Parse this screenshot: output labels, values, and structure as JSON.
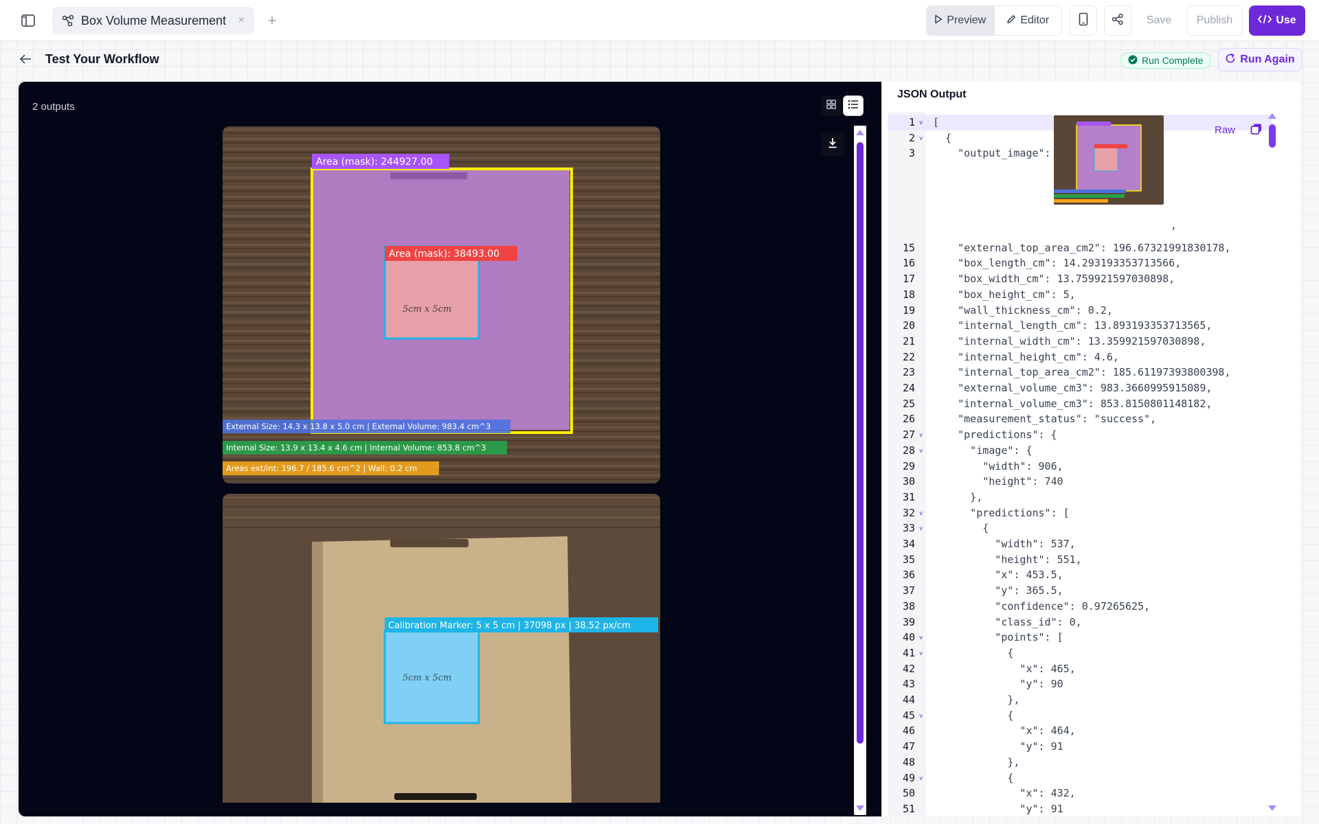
{
  "tab": {
    "label": "Box Volume Measurement",
    "close": "×",
    "add": "+"
  },
  "toolbar": {
    "preview_label": "Preview",
    "editor_label": "Editor",
    "save_label": "Save",
    "publish_label": "Publish",
    "use_label": "Use"
  },
  "header": {
    "title": "Test Your Workflow",
    "status": "Run Complete",
    "run_again_label": "Run Again"
  },
  "outputs": {
    "count_label": "2 outputs",
    "image1": {
      "area_mask_outer": "Area (mask): 244927.00",
      "area_mask_inner": "Area (mask): 38493.00",
      "external_line": "External Size: 14.3 x 13.8 x 5.0 cm | External Volume: 983.4 cm^3",
      "internal_line": "Internal Size: 13.9 x 13.4 x 4.6 cm | Internal Volume: 853.8 cm^3",
      "areas_line": "Areas ext/int: 196.7 / 185.6 cm^2 | Wall: 0.2 cm",
      "marker_text": "5cm x 5cm"
    },
    "image2": {
      "calibration_label": "Calibration Marker: 5 x 5 cm | 37098 px | 38.52 px/cm",
      "marker_text": "5cm x 5cm"
    }
  },
  "json_panel": {
    "title": "JSON Output",
    "raw_label": "Raw",
    "lines": [
      {
        "n": "1",
        "fold": true,
        "t": "["
      },
      {
        "n": "2",
        "fold": true,
        "t": "  {"
      },
      {
        "n": "3",
        "fold": false,
        "t": "    \"output_image\":"
      },
      {
        "n": "15",
        "fold": false,
        "t": "    \"external_top_area_cm2\": 196.67321991830178,"
      },
      {
        "n": "16",
        "fold": false,
        "t": "    \"box_length_cm\": 14.293193353713566,"
      },
      {
        "n": "17",
        "fold": false,
        "t": "    \"box_width_cm\": 13.759921597030898,"
      },
      {
        "n": "18",
        "fold": false,
        "t": "    \"box_height_cm\": 5,"
      },
      {
        "n": "19",
        "fold": false,
        "t": "    \"wall_thickness_cm\": 0.2,"
      },
      {
        "n": "20",
        "fold": false,
        "t": "    \"internal_length_cm\": 13.893193353713565,"
      },
      {
        "n": "21",
        "fold": false,
        "t": "    \"internal_width_cm\": 13.359921597030898,"
      },
      {
        "n": "22",
        "fold": false,
        "t": "    \"internal_height_cm\": 4.6,"
      },
      {
        "n": "23",
        "fold": false,
        "t": "    \"internal_top_area_cm2\": 185.61197393800398,"
      },
      {
        "n": "24",
        "fold": false,
        "t": "    \"external_volume_cm3\": 983.3660995915089,"
      },
      {
        "n": "25",
        "fold": false,
        "t": "    \"internal_volume_cm3\": 853.8150801148182,"
      },
      {
        "n": "26",
        "fold": false,
        "t": "    \"measurement_status\": \"success\","
      },
      {
        "n": "27",
        "fold": true,
        "t": "    \"predictions\": {"
      },
      {
        "n": "28",
        "fold": true,
        "t": "      \"image\": {"
      },
      {
        "n": "29",
        "fold": false,
        "t": "        \"width\": 906,"
      },
      {
        "n": "30",
        "fold": false,
        "t": "        \"height\": 740"
      },
      {
        "n": "31",
        "fold": false,
        "t": "      },"
      },
      {
        "n": "32",
        "fold": true,
        "t": "      \"predictions\": ["
      },
      {
        "n": "33",
        "fold": true,
        "t": "        {"
      },
      {
        "n": "34",
        "fold": false,
        "t": "          \"width\": 537,"
      },
      {
        "n": "35",
        "fold": false,
        "t": "          \"height\": 551,"
      },
      {
        "n": "36",
        "fold": false,
        "t": "          \"x\": 453.5,"
      },
      {
        "n": "37",
        "fold": false,
        "t": "          \"y\": 365.5,"
      },
      {
        "n": "38",
        "fold": false,
        "t": "          \"confidence\": 0.97265625,"
      },
      {
        "n": "39",
        "fold": false,
        "t": "          \"class_id\": 0,"
      },
      {
        "n": "40",
        "fold": true,
        "t": "          \"points\": ["
      },
      {
        "n": "41",
        "fold": true,
        "t": "            {"
      },
      {
        "n": "42",
        "fold": false,
        "t": "              \"x\": 465,"
      },
      {
        "n": "43",
        "fold": false,
        "t": "              \"y\": 90"
      },
      {
        "n": "44",
        "fold": false,
        "t": "            },"
      },
      {
        "n": "45",
        "fold": true,
        "t": "            {"
      },
      {
        "n": "46",
        "fold": false,
        "t": "              \"x\": 464,"
      },
      {
        "n": "47",
        "fold": false,
        "t": "              \"y\": 91"
      },
      {
        "n": "48",
        "fold": false,
        "t": "            },"
      },
      {
        "n": "49",
        "fold": true,
        "t": "            {"
      },
      {
        "n": "50",
        "fold": false,
        "t": "              \"x\": 432,"
      },
      {
        "n": "51",
        "fold": false,
        "t": "              \"y\": 91"
      }
    ]
  },
  "colors": {
    "accent": "#6d28d9",
    "success": "#047857",
    "panel_dark": "#020617",
    "mask_purple": "#b57fc9",
    "mask_pink": "#e8a0a8",
    "box_yellow": "#ffee00",
    "marker_cyan": "#1fb4e8",
    "label_blue": "#4f72e0",
    "label_green": "#27a24a",
    "label_orange": "#f2a41c",
    "label_red": "#f04444"
  },
  "icons": {
    "sidebar": "sidebar-icon",
    "workflow": "workflow-icon",
    "preview": "play-icon",
    "editor": "pencil-icon",
    "mobile": "phone-icon",
    "share": "share-icon",
    "use": "code-icon",
    "back": "arrow-left-icon",
    "status": "check-circle-icon",
    "run_again": "refresh-icon",
    "grid_view": "grid-icon",
    "list_view": "list-icon",
    "download": "download-icon",
    "copy": "copy-icon"
  }
}
